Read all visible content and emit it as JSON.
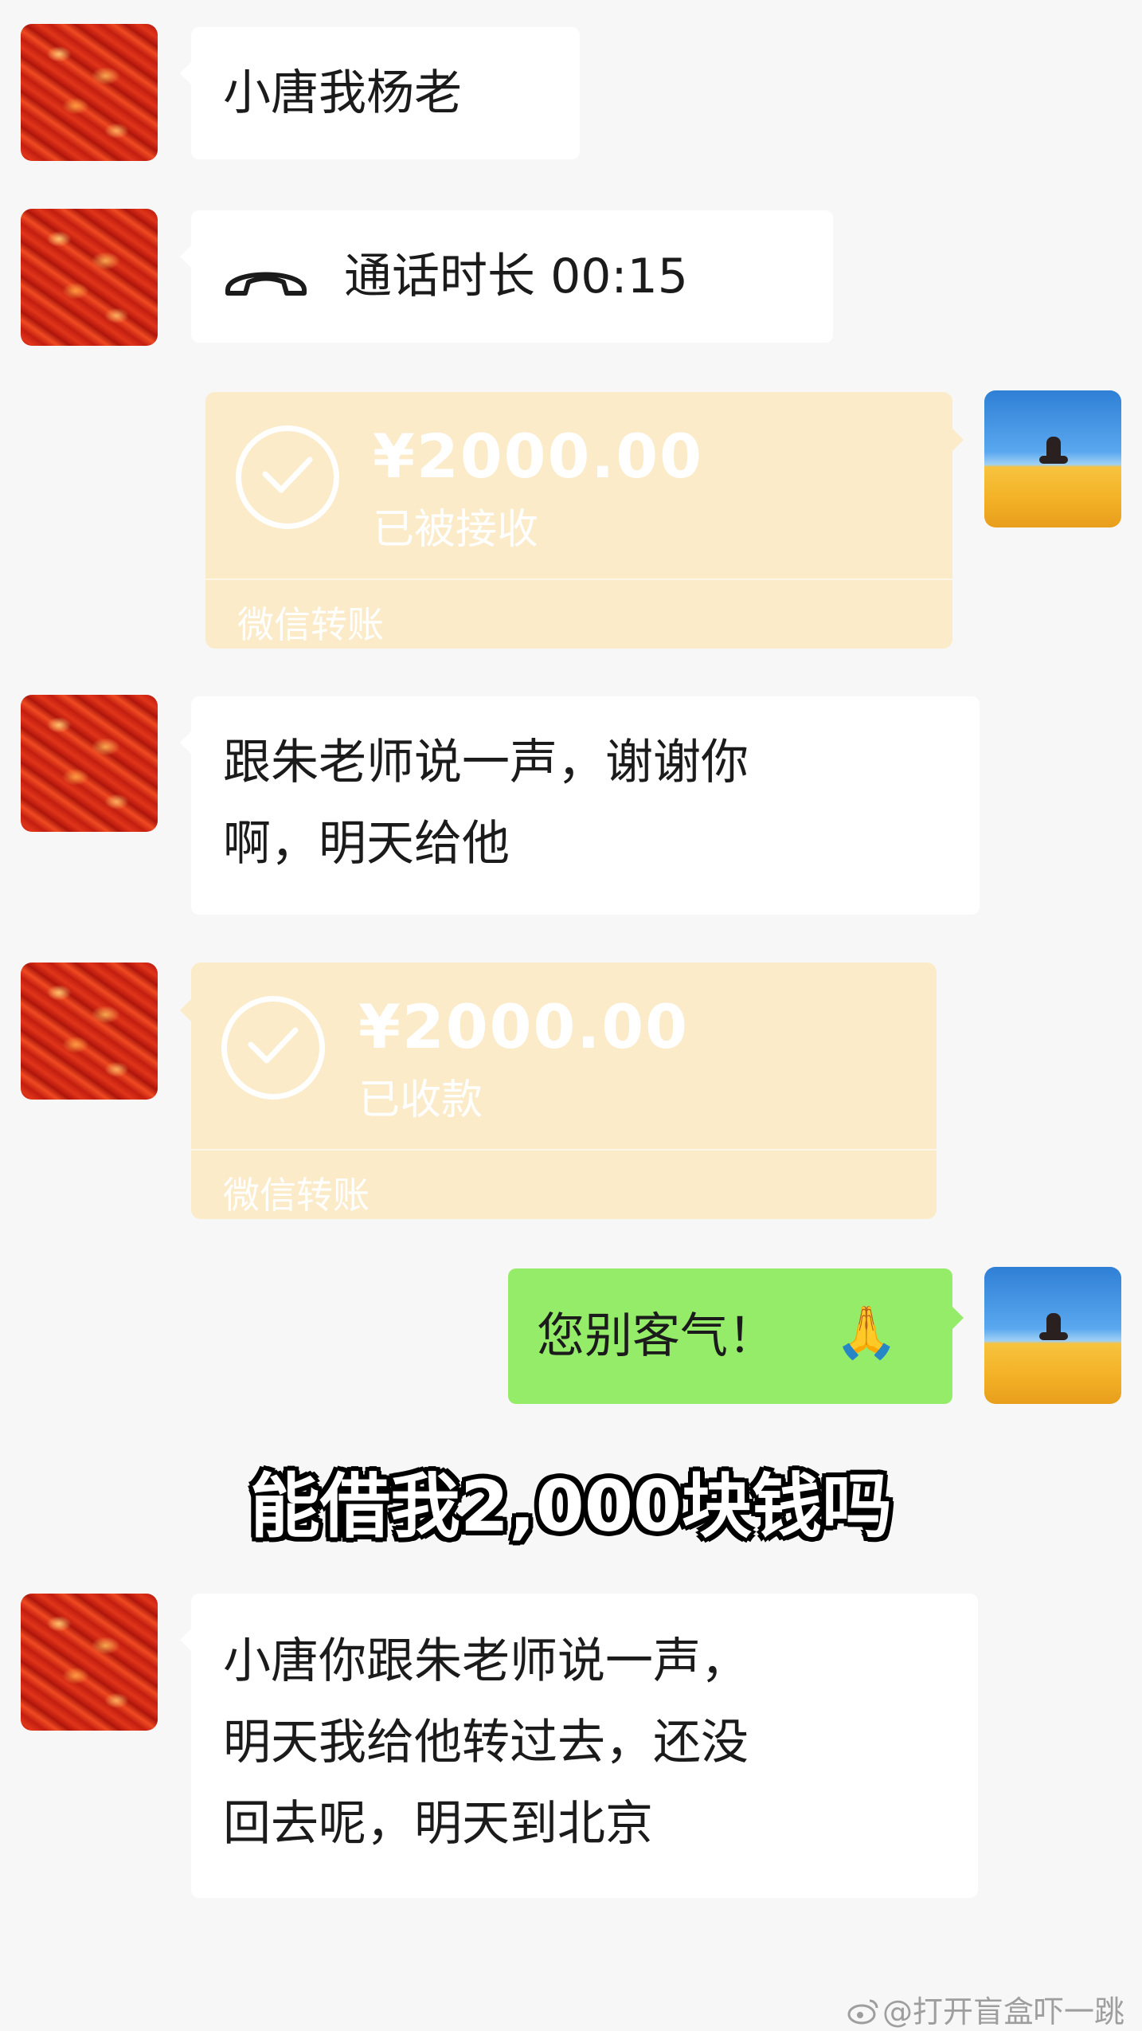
{
  "messages": {
    "m1": {
      "text": "小唐我杨老"
    },
    "m2": {
      "call_label": "通话时长 00:15",
      "icon": "phone-hangup-icon"
    },
    "m3": {
      "amount": "¥2000.00",
      "status": "已被接收",
      "brand": "微信转账"
    },
    "m4": {
      "line1": "跟朱老师说一声，谢谢你",
      "line2": "啊，明天给他"
    },
    "m5": {
      "amount": "¥2000.00",
      "status": "已收款",
      "brand": "微信转账"
    },
    "m6": {
      "text": "您别客气！",
      "emoji": "🙏"
    },
    "m7": {
      "line1": "小唐你跟朱老师说一声，",
      "line2": "明天我给他转过去，还没",
      "line3": "回去呢，明天到北京"
    }
  },
  "caption": "能借我2,000块钱吗",
  "watermark": "@打开盲盒吓一跳",
  "colors": {
    "background": "#f7f7f7",
    "bubble_received": "#ffffff",
    "bubble_sent": "#95ec69",
    "transfer_card": "#fbebc9"
  }
}
